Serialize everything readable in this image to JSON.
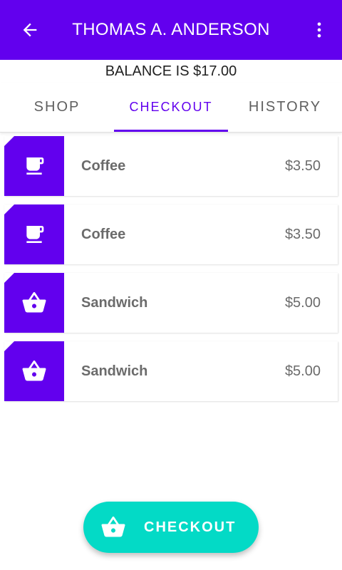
{
  "appbar": {
    "title": "THOMAS A. ANDERSON",
    "back_icon": "arrow-back-icon",
    "more_icon": "more-vert-icon"
  },
  "balance": {
    "text": "BALANCE IS $17.00"
  },
  "tabs": [
    {
      "label": "SHOP",
      "active": false
    },
    {
      "label": "CHECKOUT",
      "active": true
    },
    {
      "label": "HISTORY",
      "active": false
    }
  ],
  "cart": {
    "items": [
      {
        "name": "Coffee",
        "price": "$3.50",
        "icon": "coffee-cup-icon"
      },
      {
        "name": "Coffee",
        "price": "$3.50",
        "icon": "coffee-cup-icon"
      },
      {
        "name": "Sandwich",
        "price": "$5.00",
        "icon": "basket-icon"
      },
      {
        "name": "Sandwich",
        "price": "$5.00",
        "icon": "basket-icon"
      }
    ]
  },
  "fab": {
    "label": "CHECKOUT",
    "icon": "basket-icon"
  },
  "colors": {
    "primary": "#6200ee",
    "secondary": "#03dac6",
    "text_muted": "#6b6b6b"
  }
}
